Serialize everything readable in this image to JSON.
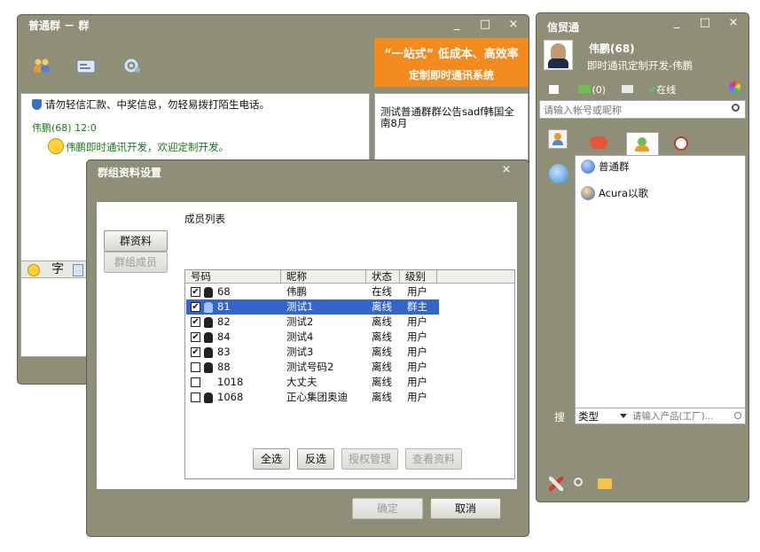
{
  "chat_window": {
    "title": "普通群 － 群",
    "ad_line1": "“一站式” 低成本、高效率",
    "ad_line2": "定制即时通讯系统",
    "warning": "请勿轻信汇款、中奖信息，勿轻易拨打陌生电话。",
    "message_sender": "伟鹏(68) 12:0",
    "message_text": "伟鹏即时通讯开发，欢迎定制开发。",
    "notice": "测试普通群群公告sadf韩国全南8月",
    "input_toolbar_char": "字"
  },
  "contact_window": {
    "title": "信贸通",
    "user_name": "伟鹏(68)",
    "user_sign": "即时通讯定制开发-伟鹏",
    "mail_count": "(0)",
    "status": "在线",
    "search_placeholder": "请输入帐号或昵称",
    "groups": [
      {
        "name": "普通群"
      },
      {
        "name": "Acura以歌"
      }
    ],
    "search_label": "搜",
    "type_select": "类型",
    "product_placeholder": "请输入产品(工厂)..."
  },
  "dialog": {
    "title": "群组资料设置",
    "side_buttons": [
      "群资料",
      "群组成员"
    ],
    "list_label": "成员列表",
    "columns": [
      "号码",
      "昵称",
      "状态",
      "级别"
    ],
    "members": [
      {
        "id": "68",
        "nickname": "伟鹏",
        "status": "在线",
        "level": "用户",
        "checked": true,
        "selected": false
      },
      {
        "id": "81",
        "nickname": "测试1",
        "status": "离线",
        "level": "群主",
        "checked": true,
        "selected": true
      },
      {
        "id": "82",
        "nickname": "测试2",
        "status": "离线",
        "level": "用户",
        "checked": true,
        "selected": false
      },
      {
        "id": "84",
        "nickname": "测试4",
        "status": "离线",
        "level": "用户",
        "checked": true,
        "selected": false
      },
      {
        "id": "83",
        "nickname": "测试3",
        "status": "离线",
        "level": "用户",
        "checked": true,
        "selected": false
      },
      {
        "id": "88",
        "nickname": "测试号码2",
        "status": "离线",
        "level": "用户",
        "checked": false,
        "selected": false
      },
      {
        "id": "1018",
        "nickname": "大丈夫",
        "status": "离线",
        "level": "用户",
        "checked": false,
        "selected": false
      },
      {
        "id": "1068",
        "nickname": "正心集团奥迪",
        "status": "离线",
        "level": "用户",
        "checked": false,
        "selected": false
      }
    ],
    "action_buttons": [
      "全选",
      "反选",
      "授权管理",
      "查看资料"
    ],
    "ok": "确定",
    "cancel": "取消"
  },
  "colors": {
    "frame": "#8e8f76",
    "accent_orange": "#f28a1e",
    "selection": "#3565c8",
    "link_green": "#1b7a1b"
  }
}
